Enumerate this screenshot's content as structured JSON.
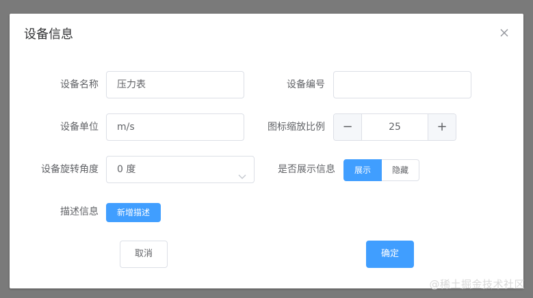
{
  "dialog": {
    "title": "设备信息",
    "close_icon": "close-icon"
  },
  "form": {
    "device_name": {
      "label": "设备名称",
      "value": "压力表"
    },
    "device_code": {
      "label": "设备编号",
      "value": ""
    },
    "device_unit": {
      "label": "设备单位",
      "value": "m/s"
    },
    "icon_scale": {
      "label": "图标缩放比例",
      "value": "25",
      "minus": "−",
      "plus": "+"
    },
    "rotation": {
      "label": "设备旋转角度",
      "value": "0 度"
    },
    "show_info": {
      "label": "是否展示信息",
      "options": [
        "展示",
        "隐藏"
      ],
      "selected": "展示"
    },
    "description": {
      "label": "描述信息",
      "button": "新增描述"
    }
  },
  "footer": {
    "cancel": "取消",
    "confirm": "确定"
  },
  "watermark": "@稀土掘金技术社区",
  "colors": {
    "primary": "#409eff",
    "border": "#dcdfe6",
    "overlay": "#7a7a7a"
  }
}
